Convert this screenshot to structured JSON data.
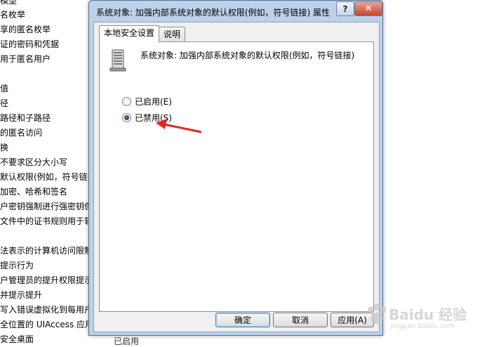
{
  "background": {
    "policies": [
      "模型",
      "名枚举",
      "享的匿名枚举",
      "证的密码和凭据",
      "用于匿名用户",
      "",
      "值",
      "径",
      "路径和子路径",
      "的匿名访问",
      "换",
      "不要求区分大小写",
      "默认权限(例如，符号链接",
      "加密、哈希和签名",
      "户密钥强制进行强密钥保护",
      "文件中的证书规则用于软",
      "",
      "法表示的计算机访问限制",
      "提示行为",
      "户管理员的提升权限提示的",
      "并提示提升",
      "写入错误虚拟化到每用户位",
      "全位置的 UIAccess 应用",
      "安全桌面"
    ],
    "status_text": "已启用"
  },
  "dialog": {
    "title": "系统对象: 加强内部系统对象的默认权限(例如，符号链接) 属性",
    "help_label": "?",
    "close_label": "✕",
    "tabs": [
      "本地安全设置",
      "说明"
    ],
    "policy_icon": "server-icon",
    "policy_name": "系统对象: 加强内部系统对象的默认权限(例如，符号链接)",
    "options": [
      {
        "label": "已启用(E)",
        "checked": false
      },
      {
        "label": "已禁用(S)",
        "checked": true
      }
    ],
    "buttons": {
      "ok": "确定",
      "cancel": "取消",
      "apply": "应用(A)"
    }
  },
  "annotation": {
    "arrow_color": "#e8231e"
  },
  "watermark": {
    "icon": "baidu-paw-icon",
    "text": "Baidu 经验",
    "subtext": "jingyan.baidu.com"
  }
}
